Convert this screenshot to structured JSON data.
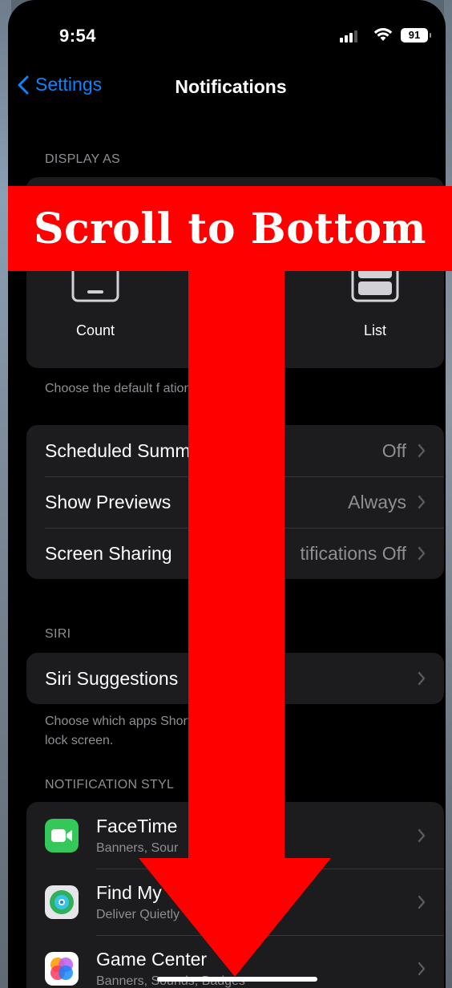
{
  "status_bar": {
    "time": "9:54",
    "battery": "91"
  },
  "nav": {
    "back_label": "Settings",
    "title": "Notifications"
  },
  "display_as": {
    "header": "DISPLAY AS",
    "options": [
      "Count",
      "List"
    ],
    "footer": "Choose the default f                        ations appear."
  },
  "settings_rows": [
    {
      "label": "Scheduled Summ",
      "value": "Off"
    },
    {
      "label": "Show Previews",
      "value": "Always"
    },
    {
      "label": "Screen Sharing",
      "value": "tifications Off"
    }
  ],
  "siri": {
    "header": "SIRI",
    "row_label": "Siri Suggestions",
    "footer_line1": "Choose which apps                          Shortcuts on the",
    "footer_line2": "lock screen."
  },
  "notification_style": {
    "header": "NOTIFICATION STYL",
    "apps": [
      {
        "name": "FaceTime",
        "subtitle": "Banners, Sour",
        "icon": "facetime-icon",
        "color": "#34c759"
      },
      {
        "name": "Find My",
        "subtitle": "Deliver Quietly",
        "icon": "find-my-icon",
        "color": "#ffffff"
      },
      {
        "name": "Game Center",
        "subtitle": "Banners, Sounds, Badges",
        "icon": "game-center-icon",
        "color": "#ffffff"
      }
    ]
  },
  "overlay": {
    "banner_text": "Scroll to Bottom",
    "color": "#ff0000"
  },
  "colors": {
    "accent": "#0a84ff",
    "background": "#000000",
    "group": "#1c1c1e",
    "secondary_text": "#8e8e93"
  }
}
